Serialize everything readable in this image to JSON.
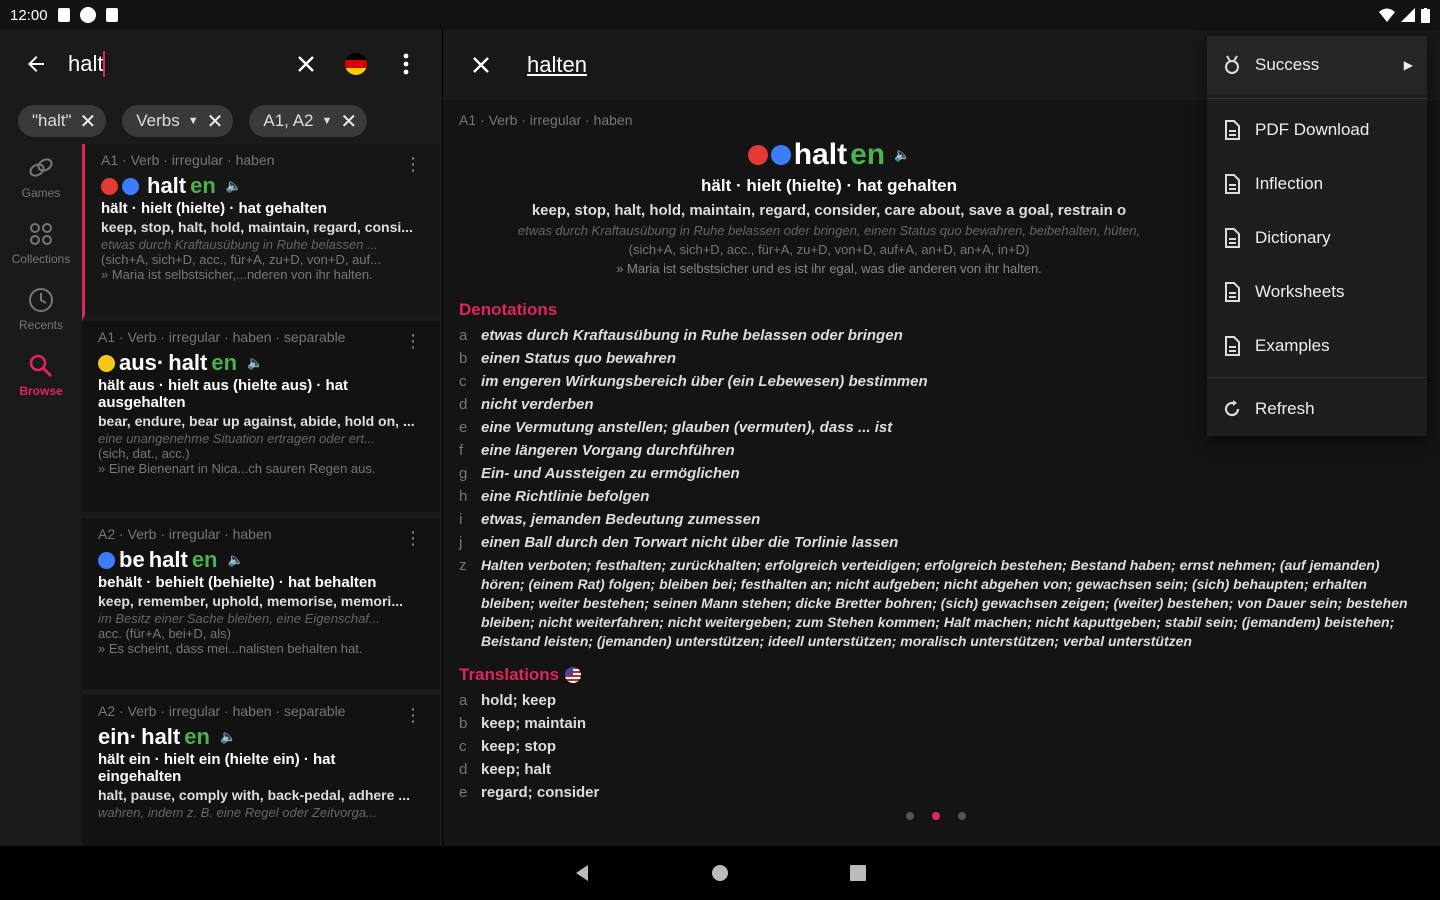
{
  "status": {
    "time": "12:00"
  },
  "search": {
    "query": "halt"
  },
  "filters": [
    {
      "label": "\"halt\"",
      "dropdown": false
    },
    {
      "label": "Verbs",
      "dropdown": true
    },
    {
      "label": "A1, A2",
      "dropdown": true
    }
  ],
  "nav": [
    {
      "label": "Games",
      "icon": "link-icon"
    },
    {
      "label": "Collections",
      "icon": "grid-icon"
    },
    {
      "label": "Recents",
      "icon": "clock-icon"
    },
    {
      "label": "Browse",
      "icon": "search-icon"
    }
  ],
  "results": [
    {
      "meta": "A1 · Verb · irregular · haben",
      "word_pre": "",
      "word_base": "halt",
      "word_end": "en",
      "forms": "hält · hielt (hielte) · hat gehalten",
      "trans": "keep, stop, halt, hold, maintain, regard, consi...",
      "def": "etwas durch Kraftausübung in Ruhe belassen ...",
      "cases": "(sich+A, sich+D, acc., für+A, zu+D, von+D, auf...",
      "ex": "» Maria ist selbstsicher,...nderen von ihr halten."
    },
    {
      "meta": "A1 · Verb · irregular · haben · separable",
      "word_pre": "aus·",
      "word_base": "halt",
      "word_end": "en",
      "forms": "hält aus · hielt aus (hielte aus) · hat ausgehalten",
      "trans": "bear, endure, bear up against, abide, hold on, ...",
      "def": "eine unangenehme Situation ertragen oder ert...",
      "cases": "(sich, dat., acc.)",
      "ex": "» Eine Bienenart in Nica...ch sauren Regen aus."
    },
    {
      "meta": "A2 · Verb · irregular · haben",
      "word_pre": "be",
      "word_base": "halt",
      "word_end": "en",
      "forms": "behält · behielt (behielte) · hat behalten",
      "trans": "keep, remember, uphold, memorise, memori...",
      "def": "im Besitz einer Sache bleiben, eine Eigenschaf...",
      "cases": "acc. (für+A, bei+D, als)",
      "ex": "» Es scheint, dass mei...nalisten behalten hat."
    },
    {
      "meta": "A2 · Verb · irregular · haben · separable",
      "word_pre": "ein·",
      "word_base": "halt",
      "word_end": "en",
      "forms": "hält ein · hielt ein (hielte ein) · hat eingehalten",
      "trans": "halt, pause, comply with, back-pedal, adhere ...",
      "def": "wahren, indem z. B. eine Regel oder Zeitvorga...",
      "cases": "",
      "ex": ""
    }
  ],
  "detail": {
    "title": "halten",
    "meta": "A1 · Verb · irregular · haben",
    "word_base": "halt",
    "word_end": "en",
    "forms": "hält · hielt (hielte) · hat gehalten",
    "trans": "keep, stop, halt, hold, maintain, regard, consider, care about, save a goal, restrain o",
    "def": "etwas durch Kraftausübung in Ruhe belassen oder bringen, einen Status quo bewahren, beibehalten, hüten,",
    "cases": "(sich+A, sich+D, acc., für+A, zu+D, von+D, auf+A, an+D, an+A, in+D)",
    "ex": "» Maria ist selbstsicher und es ist ihr egal, was die anderen von ihr halten.",
    "denotations_title": "Denotations",
    "denotations": [
      {
        "l": "a",
        "t": "etwas durch Kraftausübung in Ruhe belassen oder bringen"
      },
      {
        "l": "b",
        "t": "einen Status quo bewahren"
      },
      {
        "l": "c",
        "t": "im engeren Wirkungsbereich über (ein Lebewesen) bestimmen"
      },
      {
        "l": "d",
        "t": "nicht verderben"
      },
      {
        "l": "e",
        "t": "eine Vermutung anstellen; glauben (vermuten), dass ... ist"
      },
      {
        "l": "f",
        "t": "eine längeren Vorgang durchführen"
      },
      {
        "l": "g",
        "t": "Ein- und Aussteigen zu ermöglichen"
      },
      {
        "l": "h",
        "t": "eine Richtlinie befolgen"
      },
      {
        "l": "i",
        "t": "etwas, jemanden Bedeutung zumessen"
      },
      {
        "l": "j",
        "t": "einen Ball durch den Torwart nicht über die Torlinie lassen"
      },
      {
        "l": "z",
        "t": "Halten verboten; festhalten; zurückhalten; erfolgreich verteidigen; erfolgreich bestehen; Bestand haben; ernst nehmen; (auf jemanden) hören; (einem Rat) folgen; bleiben bei; festhalten an; nicht aufgeben; nicht abgehen von; gewachsen sein; (sich) behaupten; erhalten bleiben; weiter bestehen; seinen Mann stehen; dicke Bretter bohren; (sich) gewachsen zeigen; (weiter) bestehen; von Dauer sein; bestehen bleiben; nicht weiterfahren; nicht weitergeben; zum Stehen kommen; Halt machen; nicht kaputtgeben; stabil sein; (jemandem) beistehen; Beistand leisten; (jemanden) unterstützen; ideell unterstützen; moralisch unterstützen; verbal unterstützen"
      }
    ],
    "translations_title": "Translations",
    "translations": [
      {
        "l": "a",
        "t": "hold; keep"
      },
      {
        "l": "b",
        "t": "keep; maintain"
      },
      {
        "l": "c",
        "t": "keep; stop"
      },
      {
        "l": "d",
        "t": "keep; halt"
      },
      {
        "l": "e",
        "t": "regard; consider"
      }
    ]
  },
  "menu": {
    "items": [
      {
        "label": "Success",
        "icon": "medal-icon",
        "submenu": true
      },
      {
        "label": "PDF Download",
        "icon": "document-icon"
      },
      {
        "label": "Inflection",
        "icon": "document-icon"
      },
      {
        "label": "Dictionary",
        "icon": "document-icon"
      },
      {
        "label": "Worksheets",
        "icon": "document-icon"
      },
      {
        "label": "Examples",
        "icon": "document-icon"
      },
      {
        "label": "Refresh",
        "icon": "refresh-icon"
      }
    ]
  }
}
